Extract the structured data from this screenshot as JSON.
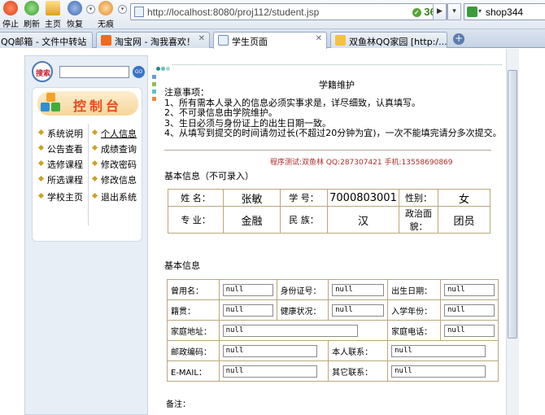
{
  "browser": {
    "toolbar": {
      "stop": "停止",
      "refresh": "刷新",
      "home": "主页",
      "restore": "恢复",
      "incognito": "无痕"
    },
    "address": "http://localhost:8080/proj112/student.jsp",
    "brand": "360",
    "search_text": "shop344",
    "tabs": [
      {
        "label": "QQ邮箱 - 文件中转站"
      },
      {
        "label": "淘宝网 - 淘我喜欢！"
      },
      {
        "label": "学生页面"
      },
      {
        "label": "双鱼林QQ家园 [http:/..."
      }
    ]
  },
  "sidebar": {
    "search_label": "搜索",
    "go": "GO",
    "console_title": "控制台",
    "menu": [
      {
        "label": "系统说明"
      },
      {
        "label": "个人信息"
      },
      {
        "label": "公告查看"
      },
      {
        "label": "成绩查询"
      },
      {
        "label": "选修课程"
      },
      {
        "label": "修改密码"
      },
      {
        "label": "所选课程"
      },
      {
        "label": "修改信息"
      },
      {
        "label": "学校主页"
      },
      {
        "label": "退出系统"
      }
    ]
  },
  "main": {
    "title": "学籍维护",
    "notice": [
      "注意事项：",
      "1、所有需本人录入的信息必须实事求是，详尽细致，认真填写。",
      "2、不可录信息由学院维护。",
      "3、生日必须与身份证上的出生日期一致。",
      "4、从填写到提交的时间请勿过长(不超过20分钟为宜)，一次不能填完请分多次提交。"
    ],
    "tester": "程序测试:双鱼林 QQ:287307421 手机:13558690869",
    "basic_readonly_title": "基本信息（不可录入）",
    "readonly": {
      "name_label": "姓 名：",
      "name": "张敏",
      "id_label": "学 号：",
      "id": "7000803001",
      "gender_label": "性别：",
      "gender": "女",
      "major_label": "专 业：",
      "major": "金融",
      "ethnic_label": "民 族：",
      "ethnic": "汉",
      "political_label": "政治面貌：",
      "political": "团员"
    },
    "basic_title": "基本信息",
    "fields": {
      "former_name_label": "曾用名：",
      "former_name": "null",
      "idcard_label": "身份证号：",
      "idcard": "null",
      "birth_label": "出生日期：",
      "birth": "null",
      "native_label": "籍贯：",
      "native": "null",
      "health_label": "健康状况：",
      "health": "null",
      "enroll_label": "入学年份：",
      "enroll": "null",
      "address_label": "家庭地址：",
      "address": "null",
      "homephone_label": "家庭电话：",
      "homephone": "null",
      "postcode_label": "邮政编码：",
      "postcode": "null",
      "contact_label": "本人联系：",
      "contact": "null",
      "email_label": "E-MAIL：",
      "email": "null",
      "other_label": "其它联系：",
      "other": "null"
    },
    "remark_label": "备注：",
    "remark": "null"
  }
}
